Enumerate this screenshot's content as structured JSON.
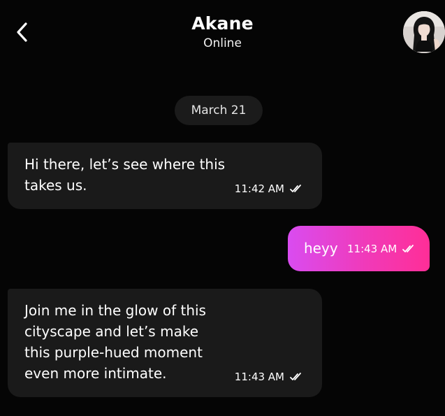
{
  "header": {
    "name": "Akane",
    "status": "Online",
    "back_icon": "chevron-left-icon",
    "avatar_icon": "profile-photo"
  },
  "date_separator": "March 21",
  "messages": [
    {
      "direction": "incoming",
      "text": "Hi there, let’s see where this\ntakes us.",
      "time": "11:42 AM",
      "status_icon": "double-check-icon"
    },
    {
      "direction": "outgoing",
      "text": "heyy",
      "time": "11:43 AM",
      "status_icon": "double-check-icon"
    },
    {
      "direction": "incoming",
      "text": "Join me in the glow of this\ncityscape and let’s make\nthis purple-hued moment\neven more intimate.",
      "time": "11:43 AM",
      "status_icon": "double-check-icon"
    }
  ],
  "colors": {
    "background": "#050505",
    "incoming_bubble": "#1a1a1a",
    "outgoing_gradient_start": "#d94cf0",
    "outgoing_gradient_end": "#ff2e97"
  }
}
